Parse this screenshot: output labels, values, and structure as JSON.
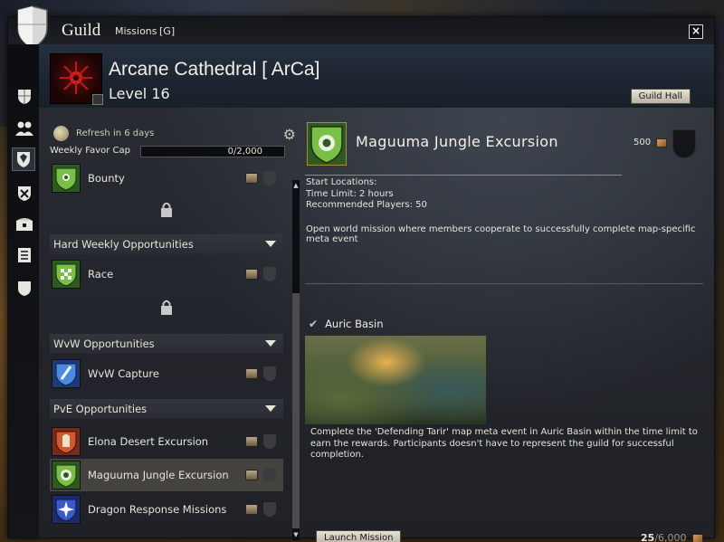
{
  "window": {
    "title": "Guild",
    "menu": [
      "Missions",
      "[G]"
    ],
    "close_label": "×"
  },
  "guild": {
    "name": "Arcane Cathedral [ ArCa]",
    "level": "Level 16",
    "hall_button": "Guild Hall"
  },
  "sidebar": {
    "items": [
      {
        "icon": "guild-crest-icon"
      },
      {
        "icon": "roster-icon"
      },
      {
        "icon": "missions-icon",
        "active": true
      },
      {
        "icon": "upgrades-icon"
      },
      {
        "icon": "treasury-icon"
      },
      {
        "icon": "log-icon"
      },
      {
        "icon": "emblem-icon"
      }
    ]
  },
  "missions": {
    "refresh_text": "Refresh in 6 days",
    "favor_cap_label": "Weekly Favor Cap",
    "favor_cap_value": "0/2,000",
    "list": [
      {
        "type": "mission",
        "name": "Bounty",
        "icon_color": "#3a7a28"
      },
      {
        "type": "lock"
      },
      {
        "type": "category",
        "name": "Hard Weekly Opportunities"
      },
      {
        "type": "mission",
        "name": "Race",
        "icon_color": "#3a7a28"
      },
      {
        "type": "lock"
      },
      {
        "type": "category",
        "name": "WvW Opportunities"
      },
      {
        "type": "mission",
        "name": "WvW Capture",
        "icon_color": "#2a5aa8"
      },
      {
        "type": "category",
        "name": "PvE Opportunities"
      },
      {
        "type": "mission",
        "name": "Elona Desert Excursion",
        "icon_color": "#a83a28"
      },
      {
        "type": "mission",
        "name": "Maguuma Jungle Excursion",
        "icon_color": "#3a7a28",
        "selected": true
      },
      {
        "type": "mission",
        "name": "Dragon Response Missions",
        "icon_color": "#2a3a9a"
      }
    ]
  },
  "detail": {
    "title": "Maguuma Jungle Excursion",
    "reward": "500",
    "start_locations": "Start Locations:",
    "time_limit": "Time Limit: 2 hours",
    "recommended_players": "Recommended Players: 50",
    "description": "Open world mission where members cooperate to successfully complete map-specific meta event",
    "location_name": "Auric Basin",
    "location_desc": "Complete the 'Defending Tarir' map meta event in Auric Basin within the time limit to earn the rewards. Participants doesn't have to represent the guild for successful completion.",
    "launch_button": "Launch Mission",
    "progress_current": "25",
    "progress_total": "/6,000"
  },
  "colors": {
    "accent_green": "#3a7a28",
    "button_face": "#d8d4c6",
    "text": "#e8e4da"
  }
}
